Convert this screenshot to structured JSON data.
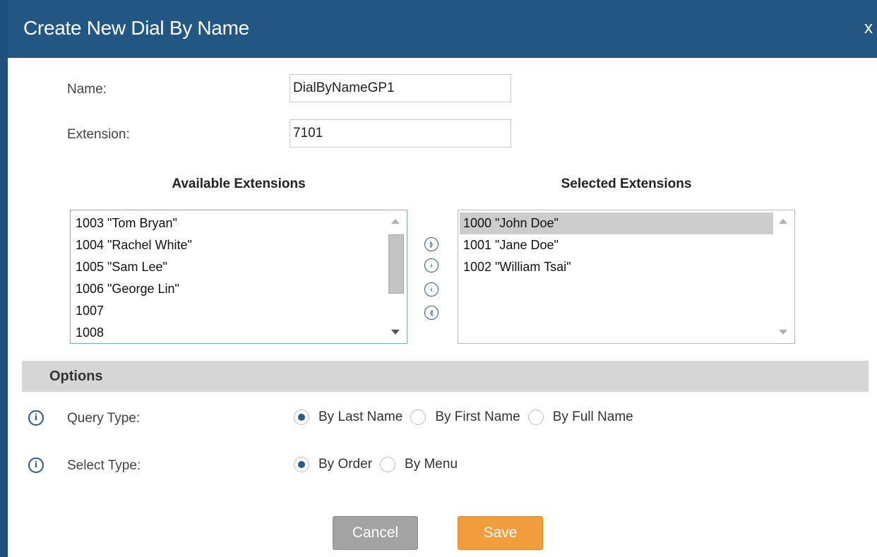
{
  "dialog": {
    "title": "Create New Dial By Name",
    "close_label": "x"
  },
  "form": {
    "name_label": "Name:",
    "name_value": "DialByNameGP1",
    "extension_label": "Extension:",
    "extension_value": "7101"
  },
  "available": {
    "header": "Available Extensions",
    "items": [
      "1003 \"Tom Bryan\"",
      "1004 \"Rachel White\"",
      "1005 \"Sam Lee\"",
      "1006 \"George Lin\"",
      "1007",
      "1008"
    ]
  },
  "selected": {
    "header": "Selected Extensions",
    "items": [
      "1000 \"John Doe\"",
      "1001 \"Jane Doe\"",
      "1002 \"William Tsai\""
    ],
    "highlighted_index": 0
  },
  "movers": {
    "add_all_icon": "⦊",
    "add_one_icon": "›",
    "remove_one_icon": "‹",
    "remove_all_icon": "⦉"
  },
  "options": {
    "title": "Options",
    "info_icon_glyph": "i",
    "query_type": {
      "label": "Query Type:",
      "choices": [
        "By Last Name",
        "By First Name",
        "By Full Name"
      ],
      "selected": "By Last Name"
    },
    "select_type": {
      "label": "Select Type:",
      "choices": [
        "By Order",
        "By Menu"
      ],
      "selected": "By Order"
    }
  },
  "buttons": {
    "cancel": "Cancel",
    "save": "Save"
  },
  "colors": {
    "titlebar": "#235783",
    "save": "#f29d3b",
    "cancel": "#a3a3a3",
    "options_bar": "#d6d6d6"
  }
}
